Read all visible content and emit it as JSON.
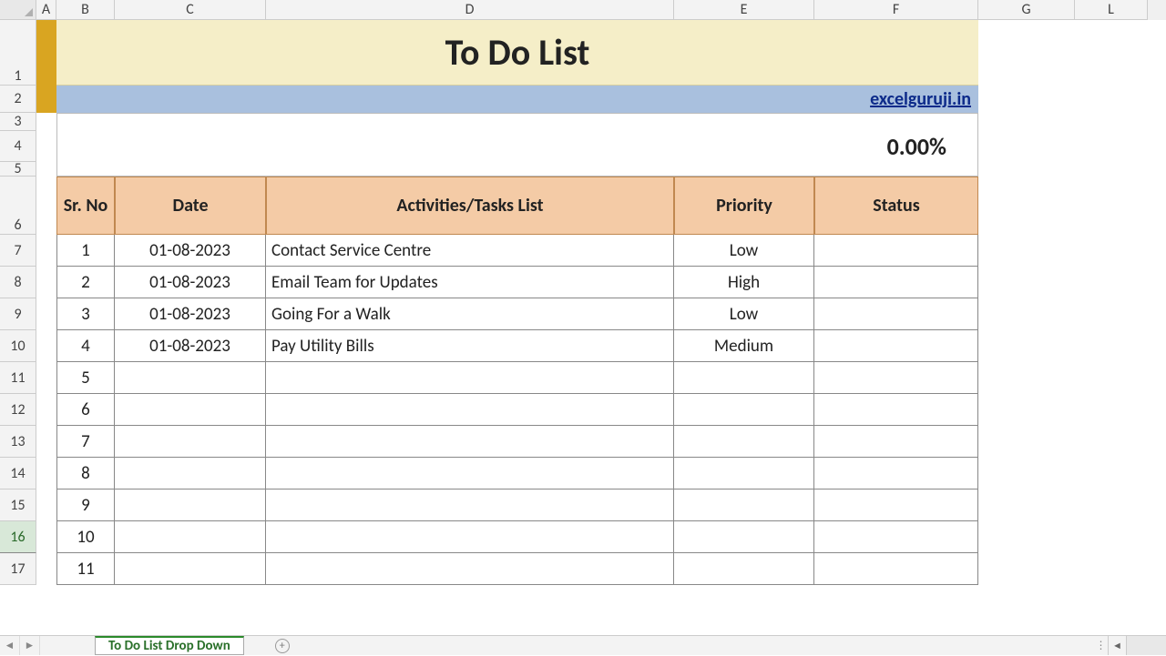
{
  "columns": [
    "A",
    "B",
    "C",
    "D",
    "E",
    "F",
    "G",
    "L"
  ],
  "row_numbers": [
    1,
    2,
    3,
    4,
    5,
    6,
    7,
    8,
    9,
    10,
    11,
    12,
    13,
    14,
    15,
    16,
    17
  ],
  "active_row_header": 16,
  "title": "To Do List",
  "subtitle_link": "excelguruji.in",
  "progress_percent": "0.00%",
  "table": {
    "headers": {
      "sr_no": "Sr. No",
      "date": "Date",
      "activities": "Activities/Tasks List",
      "priority": "Priority",
      "status": "Status"
    },
    "rows": [
      {
        "sr": "1",
        "date": "01-08-2023",
        "task": "Contact Service Centre",
        "priority": "Low",
        "status": ""
      },
      {
        "sr": "2",
        "date": "01-08-2023",
        "task": "Email Team for Updates",
        "priority": "High",
        "status": ""
      },
      {
        "sr": "3",
        "date": "01-08-2023",
        "task": "Going For a Walk",
        "priority": "Low",
        "status": ""
      },
      {
        "sr": "4",
        "date": "01-08-2023",
        "task": "Pay Utility Bills",
        "priority": "Medium",
        "status": ""
      },
      {
        "sr": "5",
        "date": "",
        "task": "",
        "priority": "",
        "status": ""
      },
      {
        "sr": "6",
        "date": "",
        "task": "",
        "priority": "",
        "status": ""
      },
      {
        "sr": "7",
        "date": "",
        "task": "",
        "priority": "",
        "status": ""
      },
      {
        "sr": "8",
        "date": "",
        "task": "",
        "priority": "",
        "status": ""
      },
      {
        "sr": "9",
        "date": "",
        "task": "",
        "priority": "",
        "status": ""
      },
      {
        "sr": "10",
        "date": "",
        "task": "",
        "priority": "",
        "status": ""
      },
      {
        "sr": "11",
        "date": "",
        "task": "",
        "priority": "",
        "status": ""
      }
    ]
  },
  "sheet_tab": "To Do List Drop Down",
  "colors": {
    "gold": "#d9a521",
    "title_bg": "#f5eec8",
    "subtitle_bg": "#a9c0de",
    "header_bg": "#f4cba6"
  }
}
